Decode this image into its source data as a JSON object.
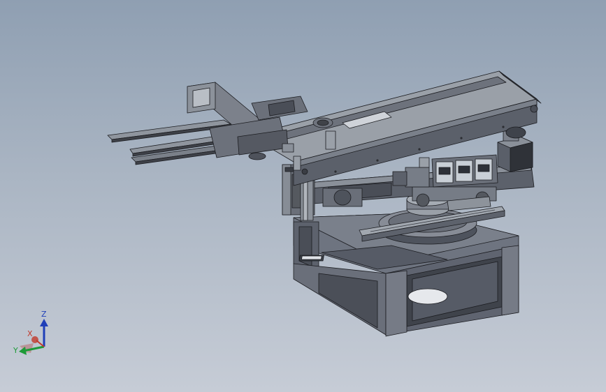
{
  "viewport": {
    "background_top": "#8f9fb2",
    "background_bottom": "#c6ccd6"
  },
  "model": {
    "description_icon": "cad-assembly-icon",
    "colors": {
      "frame": "#5d626d",
      "frame_light": "#7c818c",
      "frame_dark": "#3e424a",
      "plate": "#6e7480",
      "rail": "#9aa0a8",
      "edge": "#1b1c20",
      "screen": "#c9cfd6"
    }
  },
  "triad": {
    "z_label": "Z",
    "x_label": "X",
    "y_label": "Y",
    "z_color": "#1f3fb8",
    "x_color": "#c23a2c",
    "y_color": "#1e9a38"
  }
}
